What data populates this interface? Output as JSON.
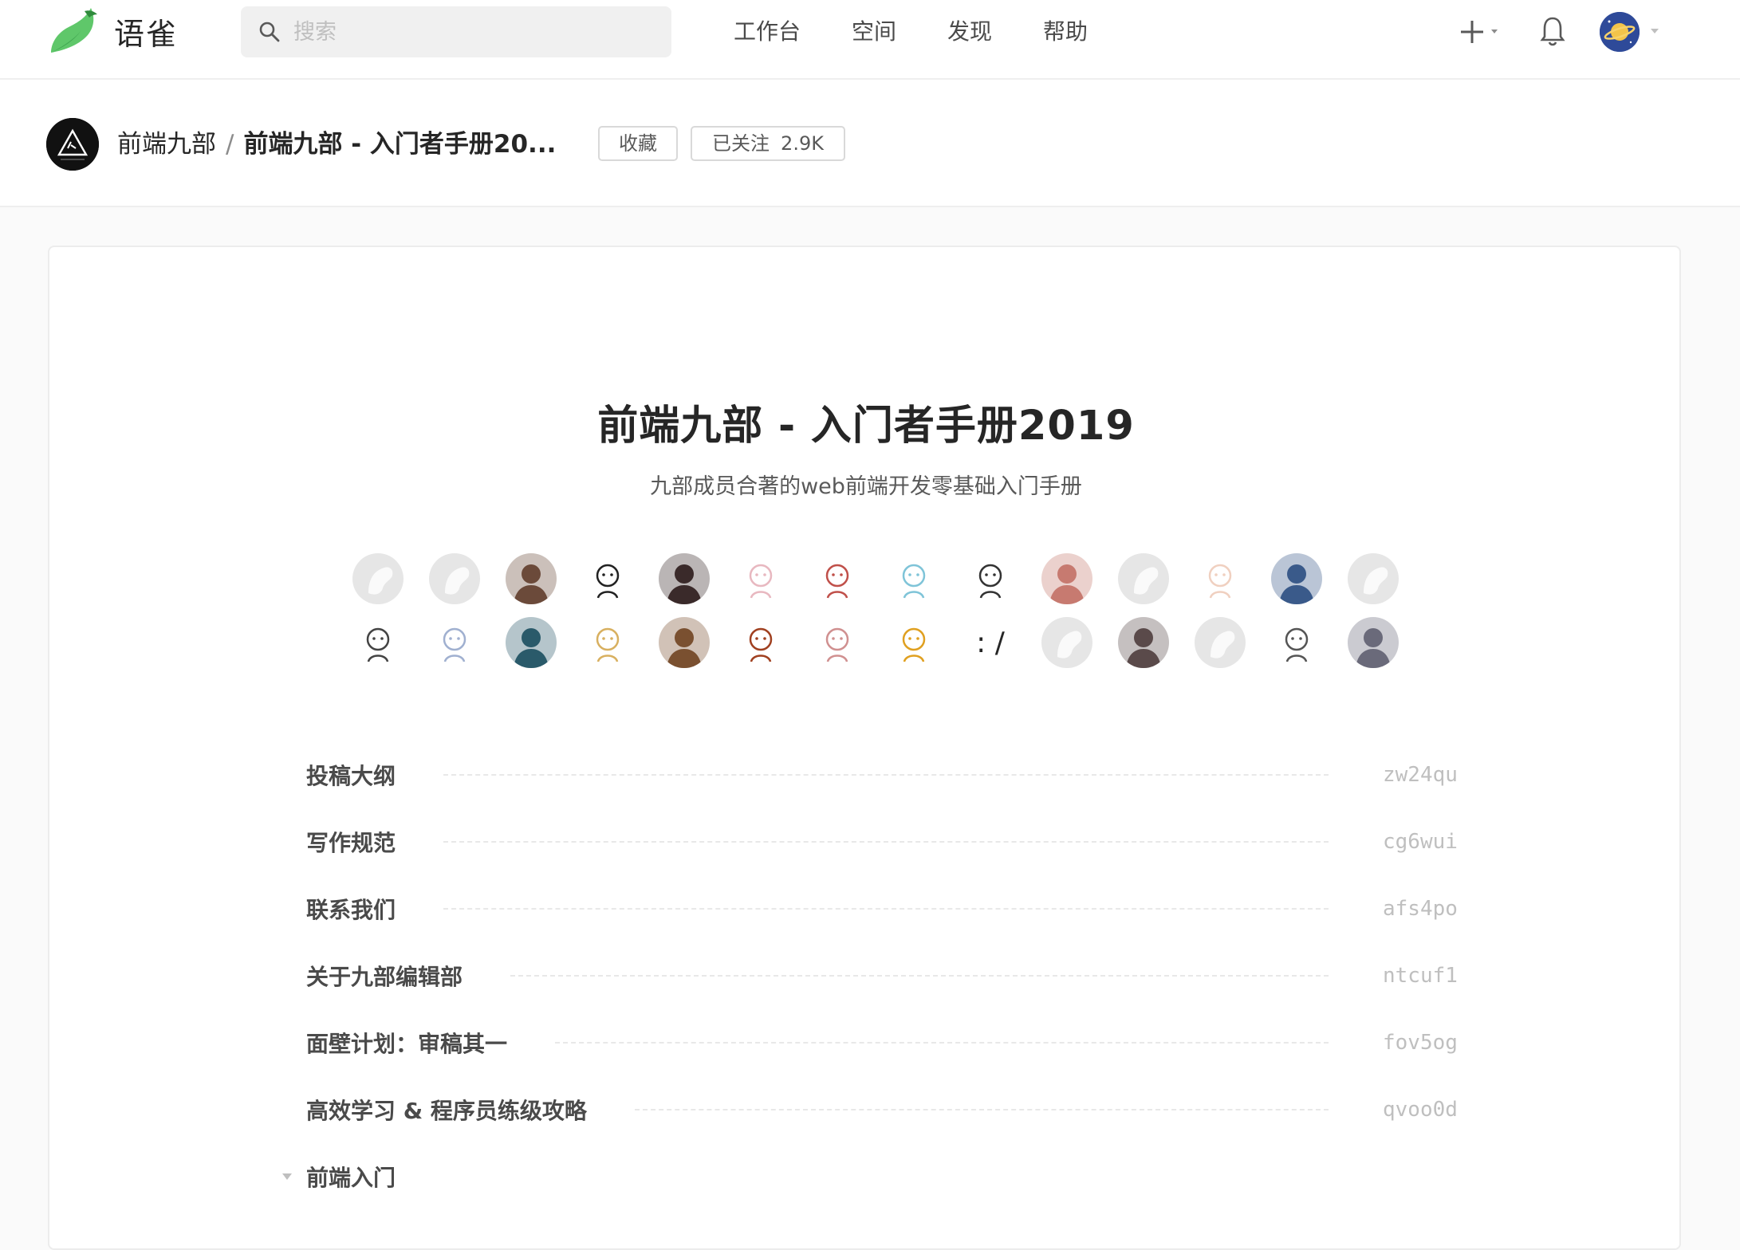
{
  "app": {
    "brand": "语雀",
    "logo_icon": "yuque-bird-icon",
    "brand_color": "#5fc76a"
  },
  "search": {
    "placeholder": "搜索",
    "icon": "search-icon"
  },
  "nav": {
    "links": [
      "工作台",
      "空间",
      "发现",
      "帮助"
    ],
    "new_icon": "plus-icon",
    "notification_icon": "bell-icon",
    "user_avatar_icon": "planet-avatar-icon"
  },
  "book": {
    "group_name": "前端九部",
    "separator": "/",
    "book_name": "前端九部 - 入门者手册20...",
    "collect_label": "收藏",
    "follow_label": "已关注",
    "follow_count": "2.9K",
    "title": "前端九部 - 入门者手册2019",
    "subtitle": "九部成员合著的web前端开发零基础入门手册"
  },
  "members": [
    {
      "kind": "default"
    },
    {
      "kind": "default"
    },
    {
      "kind": "photo",
      "color": "#6b4a3a"
    },
    {
      "kind": "cartoon",
      "color": "#222222"
    },
    {
      "kind": "photo",
      "color": "#3a2a2a"
    },
    {
      "kind": "cartoon",
      "color": "#e8b8c0"
    },
    {
      "kind": "cartoon",
      "color": "#c0504a"
    },
    {
      "kind": "cartoon",
      "color": "#7fc4d8"
    },
    {
      "kind": "cartoon",
      "color": "#333333"
    },
    {
      "kind": "photo",
      "color": "#c77a70"
    },
    {
      "kind": "default"
    },
    {
      "kind": "cartoon",
      "color": "#f0d0c0"
    },
    {
      "kind": "photo",
      "color": "#3a5a8a"
    },
    {
      "kind": "default"
    },
    {
      "kind": "cartoon",
      "color": "#444444"
    },
    {
      "kind": "cartoon",
      "color": "#a0b0d0"
    },
    {
      "kind": "photo",
      "color": "#2a5a6a"
    },
    {
      "kind": "cartoon",
      "color": "#d8b060"
    },
    {
      "kind": "photo",
      "color": "#7a5030"
    },
    {
      "kind": "cartoon",
      "color": "#a04020"
    },
    {
      "kind": "cartoon",
      "color": "#d09090"
    },
    {
      "kind": "cartoon",
      "color": "#e0a020"
    },
    {
      "kind": "text",
      "text": ": /"
    },
    {
      "kind": "default"
    },
    {
      "kind": "photo",
      "color": "#5a4a4a"
    },
    {
      "kind": "default"
    },
    {
      "kind": "cartoon",
      "color": "#555555"
    },
    {
      "kind": "photo",
      "color": "#6a6a7a"
    }
  ],
  "toc": [
    {
      "label": "投稿大纲",
      "slug": "zw24qu"
    },
    {
      "label": "写作规范",
      "slug": "cg6wui"
    },
    {
      "label": "联系我们",
      "slug": "afs4po"
    },
    {
      "label": "关于九部编辑部",
      "slug": "ntcuf1"
    },
    {
      "label": "面壁计划：审稿其一",
      "slug": "fov5og"
    },
    {
      "label": "高效学习 & 程序员练级攻略",
      "slug": "qvoo0d"
    }
  ],
  "toc_group": {
    "label": "前端入门",
    "icon": "caret-down-icon"
  }
}
